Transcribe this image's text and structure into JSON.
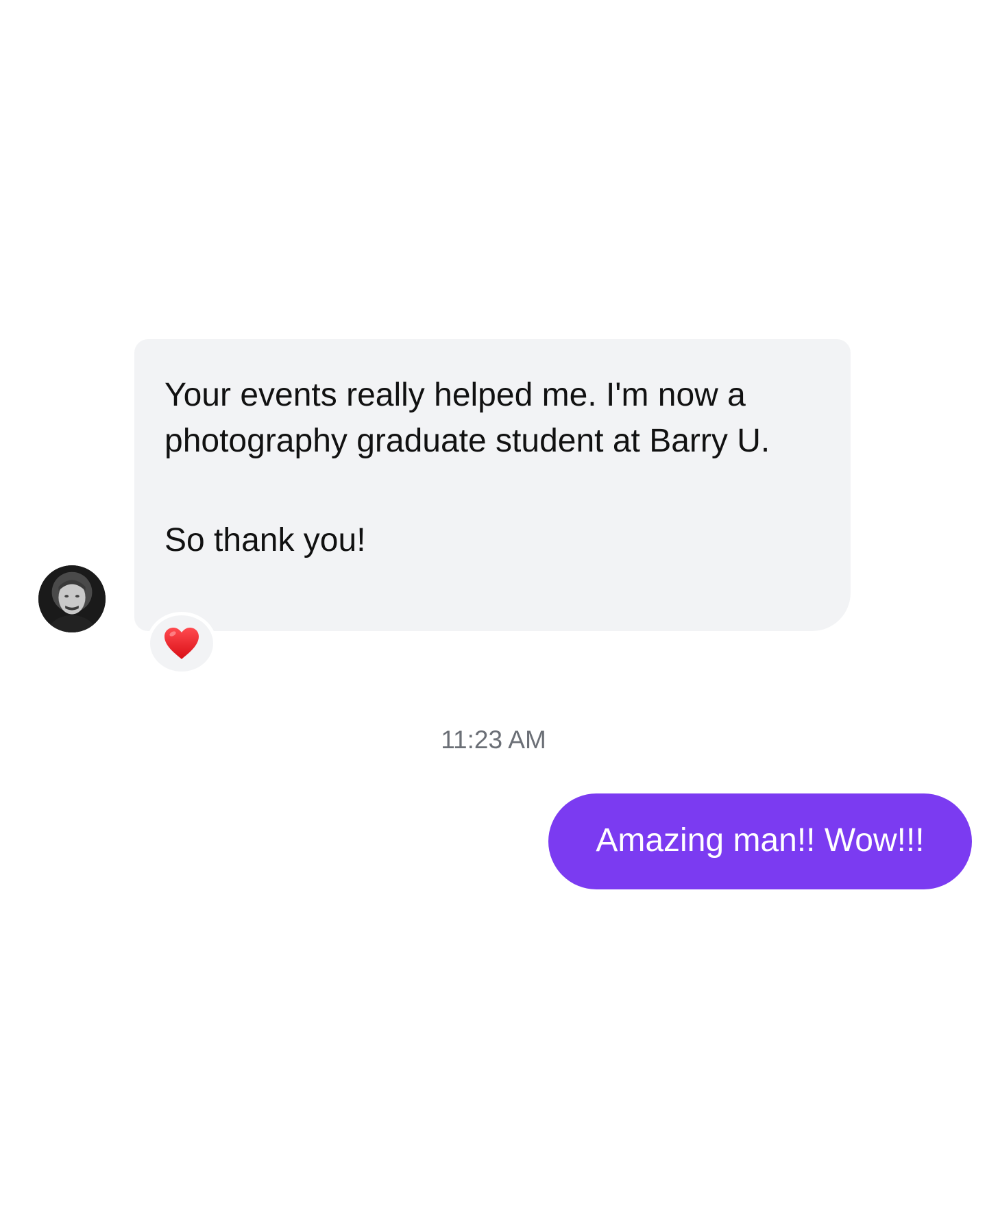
{
  "conversation": {
    "incoming": {
      "avatar_icon": "user-avatar-photo",
      "paragraphs": [
        "Your events really helped me. I'm now a photography graduate student at Barry U.",
        "So thank you!"
      ],
      "reaction": {
        "emoji": "❤️",
        "icon": "red-heart-icon",
        "color": "#e8191f"
      },
      "bubble_color": "#f2f3f5"
    },
    "timestamp": "11:23 AM",
    "outgoing": {
      "text": "Amazing man!! Wow!!!",
      "bubble_color": "#7b3bf1"
    }
  }
}
